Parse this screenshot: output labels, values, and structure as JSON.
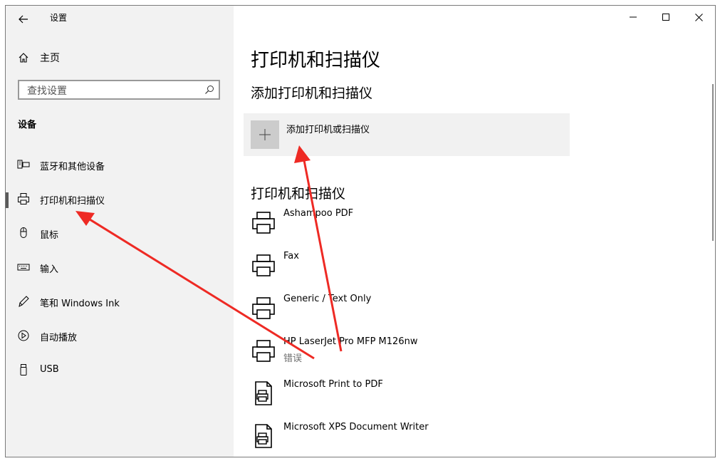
{
  "window": {
    "title": "设置"
  },
  "sidebar": {
    "home_label": "主页",
    "search_placeholder": "查找设置",
    "section_title": "设备",
    "items": [
      {
        "label": "蓝牙和其他设备",
        "icon": "bluetooth-devices-icon"
      },
      {
        "label": "打印机和扫描仪",
        "icon": "printer-icon",
        "active": true
      },
      {
        "label": "鼠标",
        "icon": "mouse-icon"
      },
      {
        "label": "输入",
        "icon": "keyboard-icon"
      },
      {
        "label": "笔和 Windows Ink",
        "icon": "pen-icon"
      },
      {
        "label": "自动播放",
        "icon": "autoplay-icon"
      },
      {
        "label": "USB",
        "icon": "usb-icon"
      }
    ]
  },
  "main": {
    "page_title": "打印机和扫描仪",
    "add_section_heading": "添加打印机和扫描仪",
    "add_button_label": "添加打印机或扫描仪",
    "list_heading": "打印机和扫描仪",
    "printers": [
      {
        "name": "Ashampoo PDF",
        "status": "",
        "icon": "printer-icon"
      },
      {
        "name": "Fax",
        "status": "",
        "icon": "printer-icon"
      },
      {
        "name": "Generic / Text Only",
        "status": "",
        "icon": "printer-icon"
      },
      {
        "name": "HP LaserJet Pro MFP M126nw",
        "status": "错误",
        "icon": "printer-icon"
      },
      {
        "name": "Microsoft Print to PDF",
        "status": "",
        "icon": "pdf-printer-icon"
      },
      {
        "name": "Microsoft XPS Document Writer",
        "status": "",
        "icon": "document-printer-icon"
      }
    ]
  },
  "annotation_color": "#ee2a24"
}
